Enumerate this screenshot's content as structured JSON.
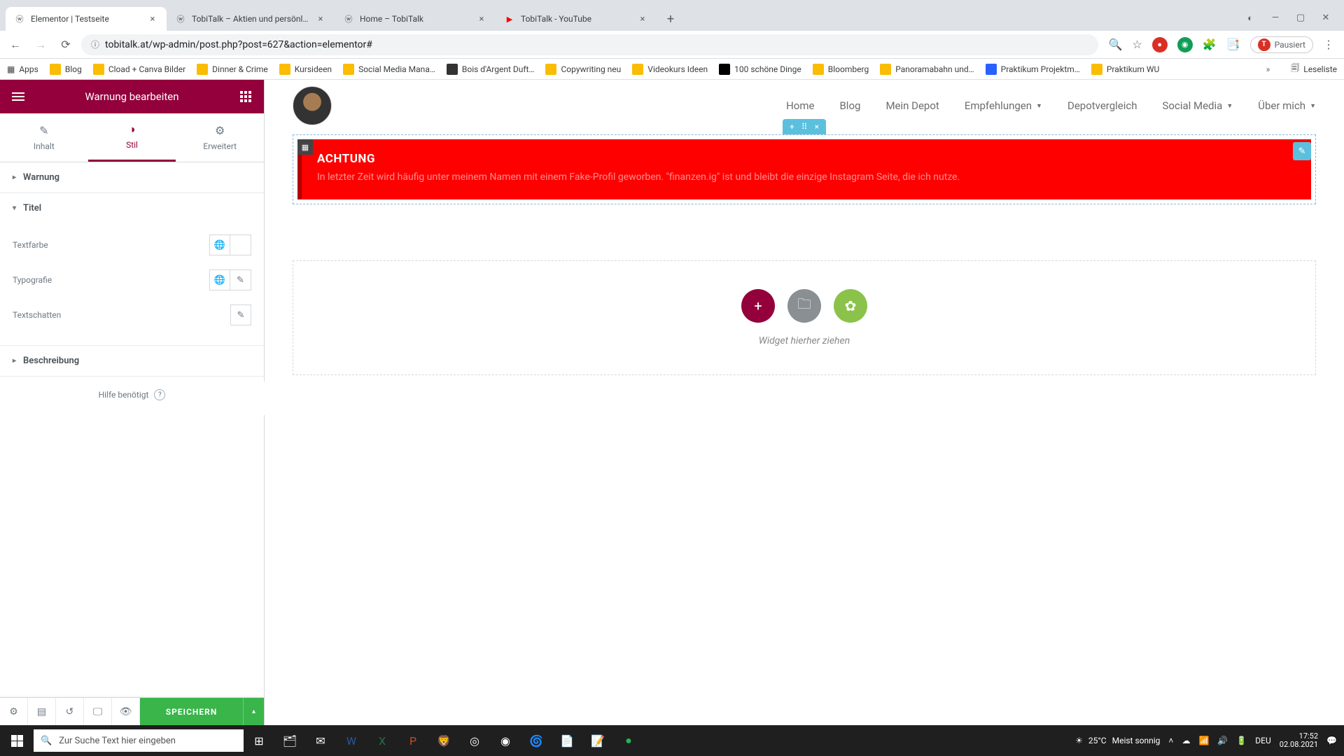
{
  "browser": {
    "tabs": [
      {
        "title": "Elementor | Testseite",
        "active": true
      },
      {
        "title": "TobiTalk – Aktien und persönlich…",
        "active": false
      },
      {
        "title": "Home – TobiTalk",
        "active": false
      },
      {
        "title": "TobiTalk - YouTube",
        "active": false
      }
    ],
    "url": "tobitalk.at/wp-admin/post.php?post=627&action=elementor#",
    "pause_label": "Pausiert",
    "avatar_letter": "T"
  },
  "bookmarks": {
    "apps": "Apps",
    "items": [
      "Blog",
      "Cload + Canva Bilder",
      "Dinner & Crime",
      "Kursideen",
      "Social Media Mana…",
      "Bois d'Argent Duft…",
      "Copywriting neu",
      "Videokurs Ideen",
      "100 schöne Dinge",
      "Bloomberg",
      "Panoramabahn und…",
      "Praktikum Projektm…",
      "Praktikum WU"
    ],
    "reading_list": "Leseliste"
  },
  "elementor": {
    "header_title": "Warnung bearbeiten",
    "tabs": {
      "content": "Inhalt",
      "style": "Stil",
      "advanced": "Erweitert"
    },
    "accordions": {
      "warning": "Warnung",
      "title": "Titel",
      "description": "Beschreibung"
    },
    "controls": {
      "text_color": "Textfarbe",
      "typography": "Typografie",
      "text_shadow": "Textschatten"
    },
    "help": "Hilfe benötigt",
    "save": "SPEICHERN"
  },
  "site_nav": {
    "items": [
      "Home",
      "Blog",
      "Mein Depot",
      "Empfehlungen",
      "Depotvergleich",
      "Social Media",
      "Über mich"
    ],
    "dropdown_idx": [
      3,
      5,
      6
    ]
  },
  "alert": {
    "title": "ACHTUNG",
    "desc": "In letzter Zeit wird häufig unter meinem Namen mit einem Fake-Profil geworben. \"finanzen.ig\" ist und bleibt die einzige Instagram Seite, die ich nutze."
  },
  "drop": {
    "label": "Widget hierher ziehen"
  },
  "taskbar": {
    "search_placeholder": "Zur Suche Text hier eingeben",
    "weather_temp": "25°C",
    "weather_desc": "Meist sonnig",
    "lang": "DEU",
    "time": "17:52",
    "date": "02.08.2021"
  }
}
